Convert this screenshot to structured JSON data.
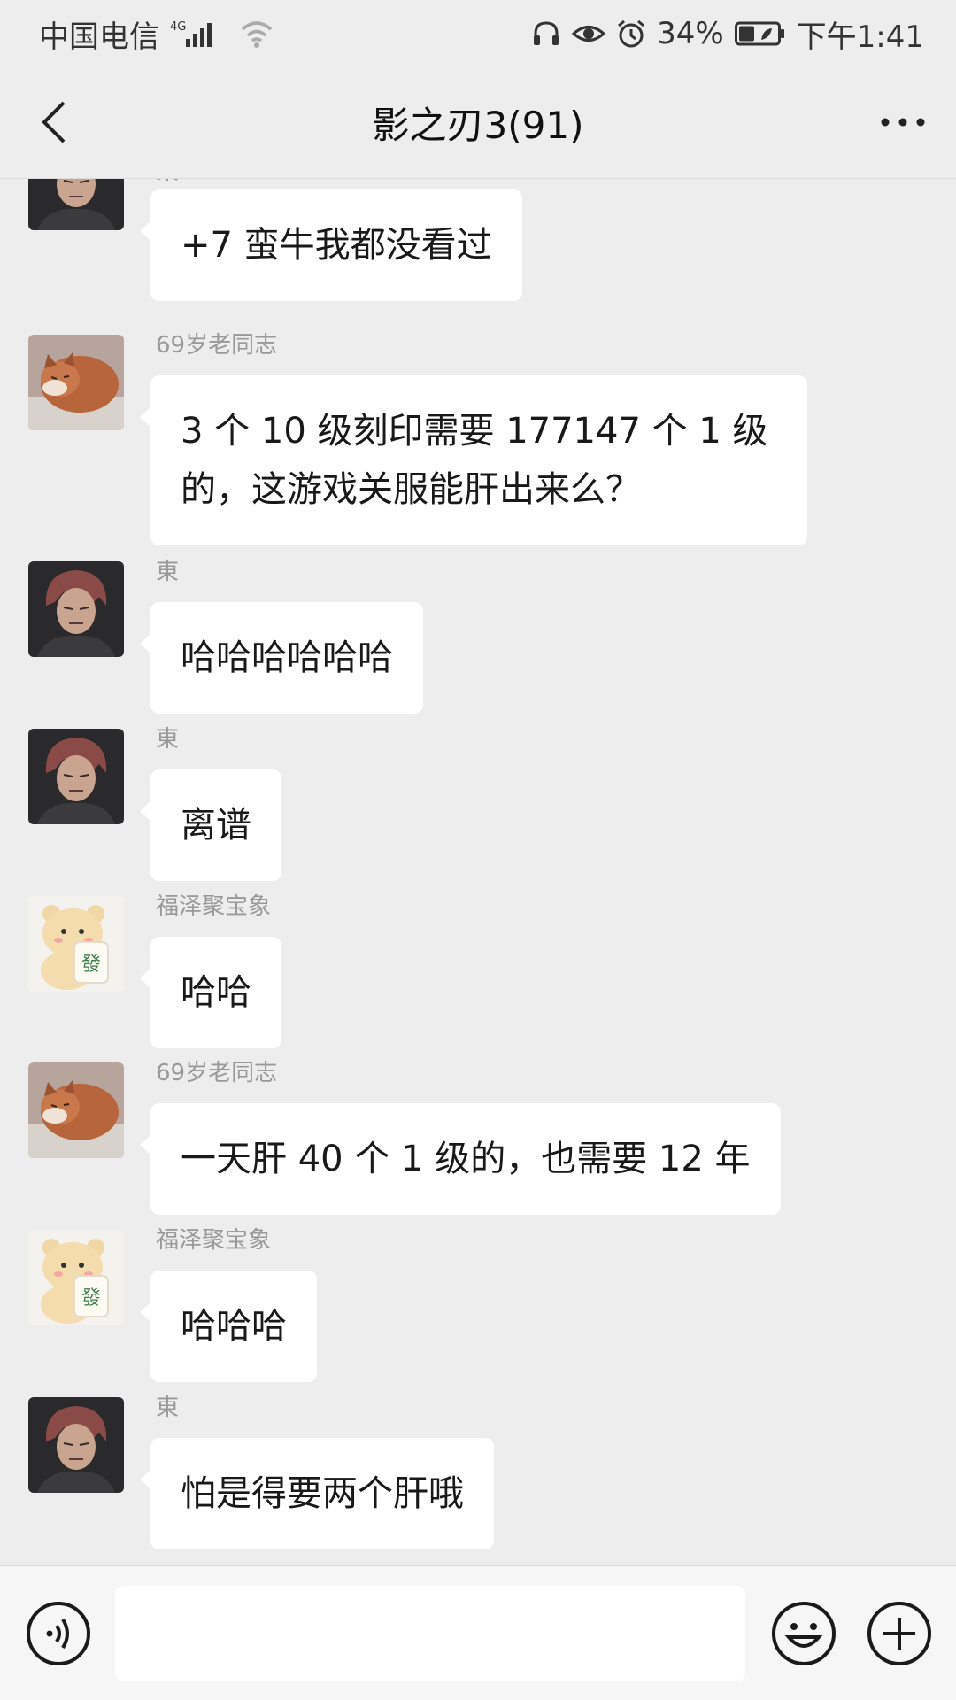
{
  "status_bar": {
    "carrier": "中国电信",
    "network": "4G",
    "battery": "34%",
    "time": "下午1:41"
  },
  "header": {
    "title": "影之刃3(91)"
  },
  "messages": [
    {
      "sender": "東",
      "text": "+7 蛮牛我都没看过",
      "avatar": "anime-boy-avatar"
    },
    {
      "sender": "69岁老同志",
      "text": "3 个 10 级刻印需要 177147 个 1 级的，这游戏关服能肝出来么？",
      "avatar": "cat-avatar"
    },
    {
      "sender": "東",
      "text": "哈哈哈哈哈哈",
      "avatar": "anime-boy-avatar"
    },
    {
      "sender": "東",
      "text": "离谱",
      "avatar": "anime-boy-avatar"
    },
    {
      "sender": "福泽聚宝象",
      "text": "哈哈",
      "avatar": "bear-avatar"
    },
    {
      "sender": "69岁老同志",
      "text": "一天肝 40 个 1 级的，也需要 12 年",
      "avatar": "cat-avatar"
    },
    {
      "sender": "福泽聚宝象",
      "text": "哈哈哈",
      "avatar": "bear-avatar"
    },
    {
      "sender": "東",
      "text": "怕是得要两个肝哦",
      "avatar": "anime-boy-avatar"
    }
  ],
  "input_bar": {
    "text_value": "",
    "avatar_badge": "發"
  },
  "colors": {
    "background": "#ededed",
    "bubble": "#ffffff",
    "name_text": "#999999"
  }
}
